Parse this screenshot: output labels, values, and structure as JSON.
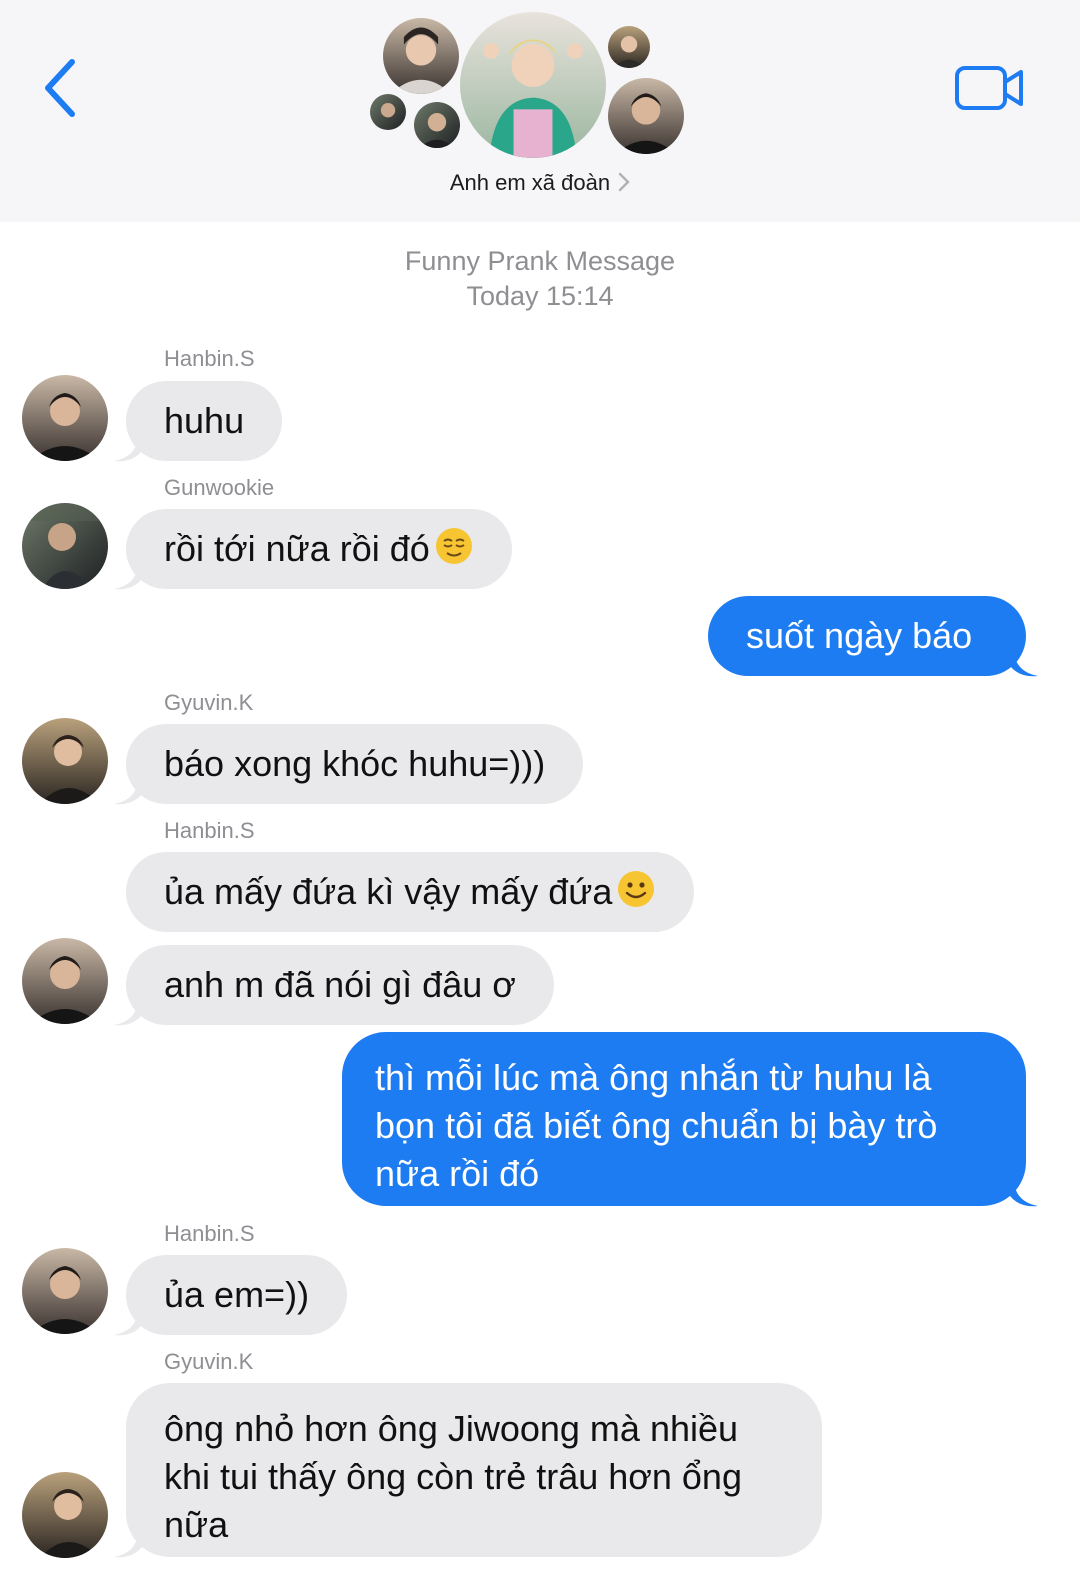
{
  "header": {
    "group_name": "Anh em xã đoàn",
    "accent_color": "#1e7cf2",
    "back_icon": "chevron-left-icon",
    "video_icon": "video-camera-icon"
  },
  "conversation": {
    "title": "Funny Prank Message",
    "timestamp": "Today 15:14"
  },
  "messages": [
    {
      "sender": "Hanbin.S",
      "text": "huhu",
      "direction": "incoming"
    },
    {
      "sender": "Gunwookie",
      "text": "rồi tới nữa rồi đó",
      "emoji": "relieved-face-emoji",
      "direction": "incoming"
    },
    {
      "text": "suốt ngày báo",
      "direction": "outgoing"
    },
    {
      "sender": "Gyuvin.K",
      "text": "báo xong khóc huhu=)))",
      "direction": "incoming"
    },
    {
      "sender": "Hanbin.S",
      "text": "ủa mấy đứa kì vậy mấy đứa",
      "emoji": "smiling-face-emoji",
      "direction": "incoming"
    },
    {
      "text": "anh m đã nói gì đâu ơ",
      "direction": "incoming"
    },
    {
      "lines": [
        "thì mỗi lúc mà ông nhắn từ huhu là",
        "bọn tôi đã biết ông chuẩn bị bày trò",
        "nữa rồi đó"
      ],
      "direction": "outgoing"
    },
    {
      "sender": "Hanbin.S",
      "text": "ủa em=))",
      "direction": "incoming"
    },
    {
      "sender": "Gyuvin.K",
      "lines": [
        "ông nhỏ hơn ông Jiwoong mà nhiều",
        "khi tui thấy ông còn trẻ trâu hơn ổng",
        "nữa"
      ],
      "direction": "incoming"
    }
  ]
}
